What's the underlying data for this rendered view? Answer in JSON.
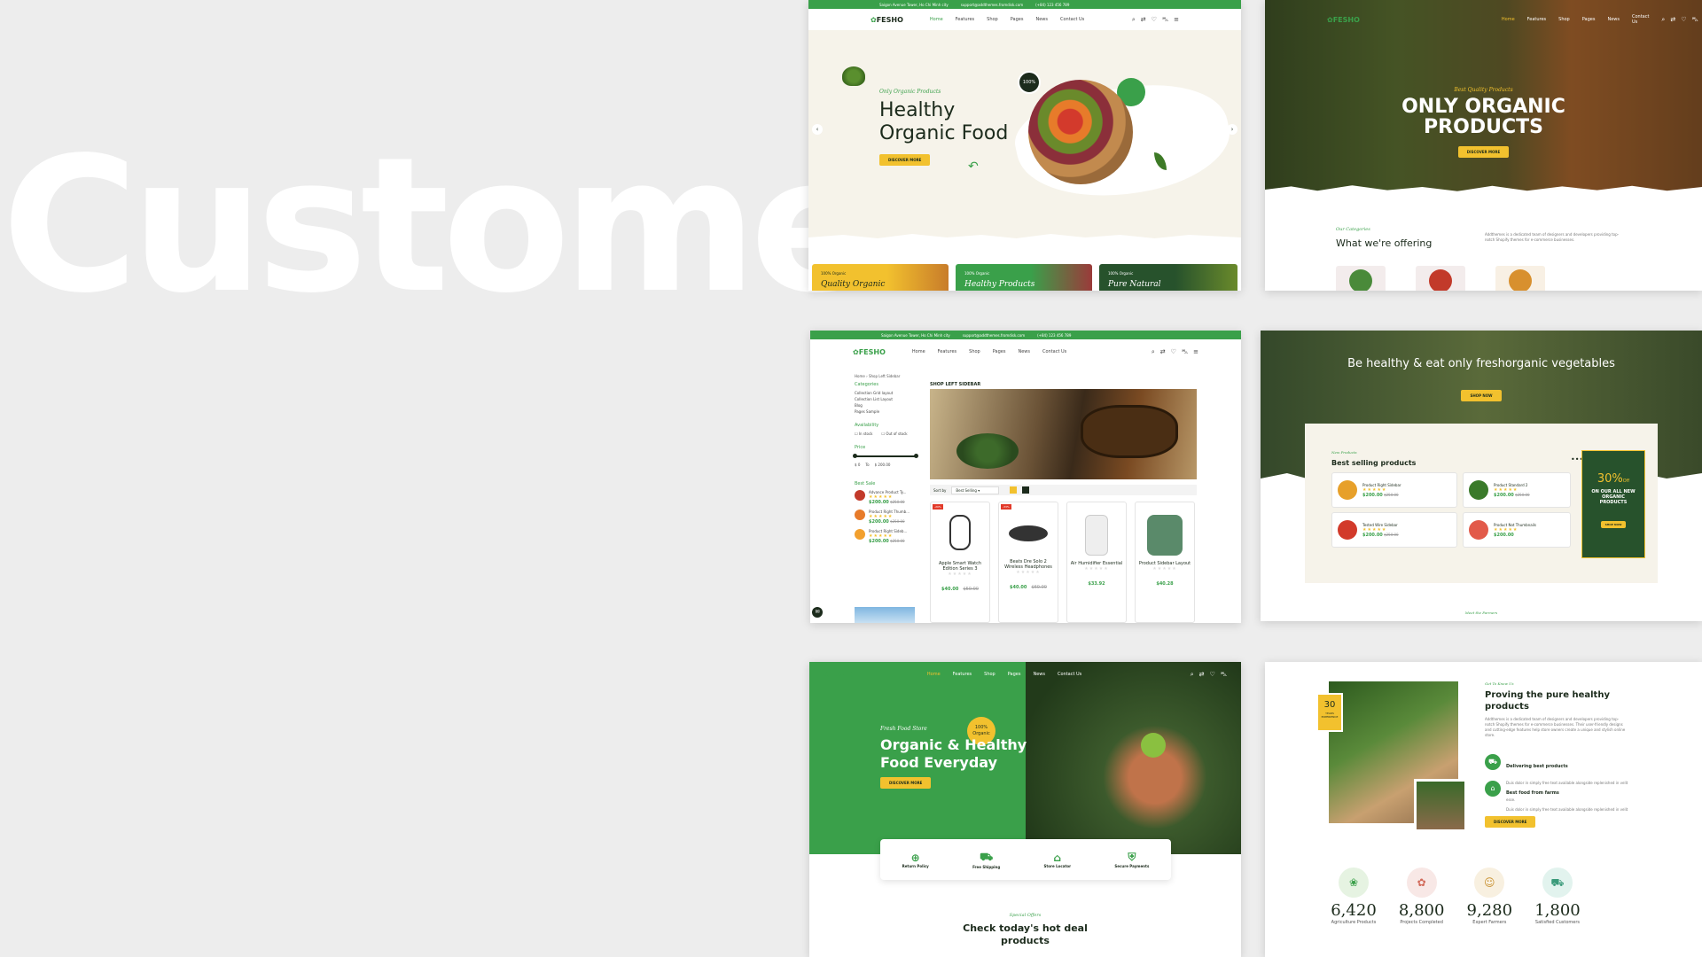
{
  "hero_word": "Customer",
  "shot1": {
    "topbar": [
      "Saigon Avenue Tower, Ho Chi Minh city",
      "support@addthemes.fromdisk.com",
      "(+84) 123 456 789"
    ],
    "logo": "FESHO",
    "nav": [
      "Home",
      "Features",
      "Shop",
      "Pages",
      "News",
      "Contact Us"
    ],
    "tagline": "Only Organic Products",
    "headline1": "Healthy",
    "headline2": "Organic Food",
    "button": "DISCOVER MORE",
    "badge": "100%",
    "promos": [
      {
        "tag": "100% Organic",
        "title": "Quality Organic"
      },
      {
        "tag": "100% Organic",
        "title": "Healthy Products"
      },
      {
        "tag": "100% Organic",
        "title": "Pure Natural"
      }
    ]
  },
  "shot2": {
    "logo": "FESHO",
    "nav": [
      "Home",
      "Features",
      "Shop",
      "Pages",
      "News",
      "Contact Us"
    ],
    "tagline": "Best Quality Products",
    "headline1": "ONLY ORGANIC",
    "headline2": "PRODUCTS",
    "button": "DISCOVER MORE",
    "section_tag": "Our Categories",
    "section_title": "What we're offering",
    "section_desc": "Addthemes is a dedicated team of designers and developers providing top-notch Shopify themes for e-commerce businesses."
  },
  "shot3": {
    "topbar": [
      "Saigon Avenue Tower, Ho Chi Minh city",
      "support@addthemes.fromdisk.com",
      "(+84) 123 456 789"
    ],
    "logo": "FESHO",
    "nav": [
      "Home",
      "Features",
      "Shop",
      "Pages",
      "News",
      "Contact Us"
    ],
    "breadcrumb": [
      "Home",
      "Shop Left Sidebar"
    ],
    "sidebar": {
      "categories_title": "Categories",
      "categories": [
        "Collection Grid layout",
        "Collection List Layout",
        "Blog",
        "Pages Sample"
      ],
      "availability_title": "Availability",
      "availability": [
        "In stock",
        "Out of stock"
      ],
      "price_title": "Price",
      "price_from": "0",
      "price_to": "200.00",
      "price_to_label": "To",
      "best_sale_title": "Best Sale",
      "best_sale": [
        {
          "name": "Advance Product Ty...",
          "price": "$200.00",
          "old": "$250.00"
        },
        {
          "name": "Product Right Thumb...",
          "price": "$200.00",
          "old": "$250.00"
        },
        {
          "name": "Product Right Sideb...",
          "price": "$200.00",
          "old": "$250.00"
        }
      ]
    },
    "page_title": "SHOP LEFT SIDEBAR",
    "sort_label": "Sort by",
    "sort_value": "Best Selling",
    "products": [
      {
        "name": "Apple Smart Watch Edition Series 3",
        "price": "$40.00",
        "old": "$50.00",
        "sale": "-20%"
      },
      {
        "name": "Beats Dre Solo 2 Wireless Headphones",
        "price": "$40.00",
        "old": "$60.00",
        "sale": "-33%"
      },
      {
        "name": "Air Humidifier Essential",
        "price": "$33.92",
        "old": "",
        "sale": ""
      },
      {
        "name": "Product Sidebar Layout",
        "price": "$40.28",
        "old": "",
        "sale": ""
      }
    ]
  },
  "shot4": {
    "headline": "Be healthy & eat only freshorganic vegetables",
    "button": "SHOP NOW",
    "panel_tag": "New Products",
    "panel_title": "Best selling products",
    "products": [
      {
        "name": "Product Right Sidebar",
        "price": "$200.00",
        "old": "$250.00"
      },
      {
        "name": "Product Standard 2",
        "price": "$200.00",
        "old": "$250.00"
      },
      {
        "name": "Tested Wire Sidebar",
        "price": "$200.00",
        "old": "$250.00"
      },
      {
        "name": "Product Not Thumbnails",
        "price": "$200.00",
        "old": ""
      }
    ],
    "promo_percent": "30%",
    "promo_off": "Off",
    "promo_text": "ON OUR ALL NEW ORGANIC PRODUCTS",
    "promo_button": "SHOP NOW",
    "footer_text": "Meet the Farmers"
  },
  "shot5": {
    "logo": "FESHO",
    "nav": [
      "Home",
      "Features",
      "Shop",
      "Pages",
      "News",
      "Contact Us"
    ],
    "tagline": "Fresh Food Store",
    "headline1": "Organic & Healthy",
    "headline2": "Food Everyday",
    "badge": "100% Organic",
    "button": "DISCOVER MORE",
    "features": [
      "Return Policy",
      "Free Shipping",
      "Store Locator",
      "Secure Payments"
    ],
    "section_tag": "Special Offers",
    "section_title1": "Check today's hot deal",
    "section_title2": "products"
  },
  "shot6": {
    "years": "30",
    "years_label": "YEARS EXPERIENCE",
    "tag": "Get To Know Us",
    "title1": "Proving the pure healthy",
    "title2": "products",
    "desc": "Addthemes is a dedicated team of designers and developers providing top-notch Shopify themes for e-commerce businesses. Their user-friendly designs and cutting-edge features help store owners create a unique and stylish online store.",
    "features": [
      {
        "title": "Delivering best products",
        "desc": "Duis dolor in simply free text available alongside replenished in velit esse."
      },
      {
        "title": "Best food from farms",
        "desc": "Duis dolor in simply free text available alongside replenished in velit esse."
      }
    ],
    "button": "DISCOVER MORE",
    "stats": [
      {
        "value": "6,420",
        "label": "Agriculture Products"
      },
      {
        "value": "8,800",
        "label": "Projects Completed"
      },
      {
        "value": "9,280",
        "label": "Expert Farmers"
      },
      {
        "value": "1,800",
        "label": "Satisfied Customers"
      }
    ]
  },
  "colors": {
    "green": "#3aa04a",
    "yellow": "#f2c12e",
    "dark_green": "#27522c",
    "cream": "#f6f3ea"
  }
}
